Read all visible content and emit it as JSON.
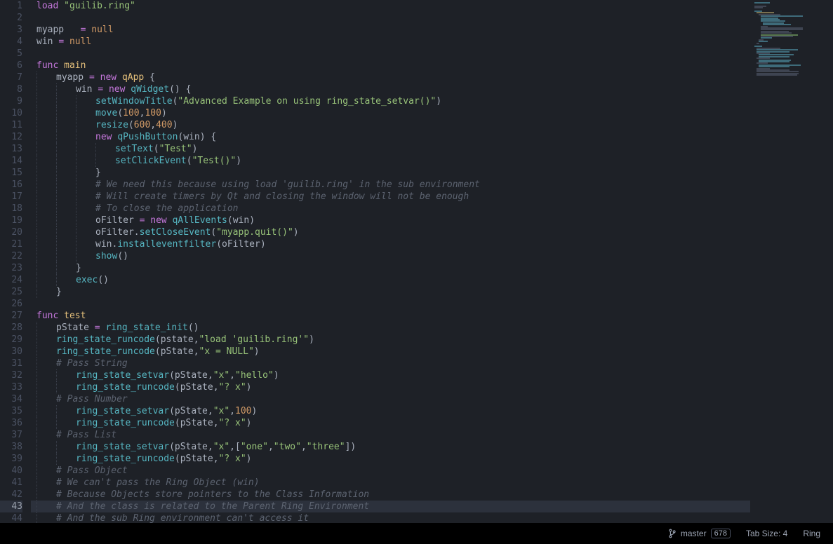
{
  "language": "Ring",
  "status": {
    "branch_label": "master",
    "change_count": "678",
    "tab_size_label": "Tab Size: 4",
    "language_label": "Ring"
  },
  "current_line": 43,
  "lines": [
    {
      "n": 1,
      "indent": 0,
      "tokens": [
        [
          "kw",
          "load"
        ],
        [
          "sp",
          " "
        ],
        [
          "str",
          "\"guilib.ring\""
        ]
      ]
    },
    {
      "n": 2,
      "indent": 0,
      "tokens": []
    },
    {
      "n": 3,
      "indent": 0,
      "tokens": [
        [
          "id",
          "myapp   "
        ],
        [
          "eq",
          "="
        ],
        [
          "sp",
          " "
        ],
        [
          "null",
          "null"
        ]
      ]
    },
    {
      "n": 4,
      "indent": 0,
      "tokens": [
        [
          "id",
          "win "
        ],
        [
          "eq",
          "="
        ],
        [
          "sp",
          " "
        ],
        [
          "null",
          "null"
        ]
      ]
    },
    {
      "n": 5,
      "indent": 0,
      "tokens": []
    },
    {
      "n": 6,
      "indent": 0,
      "tokens": [
        [
          "kw",
          "func"
        ],
        [
          "sp",
          " "
        ],
        [
          "name",
          "main"
        ]
      ]
    },
    {
      "n": 7,
      "indent": 1,
      "tokens": [
        [
          "id",
          "myapp "
        ],
        [
          "eq",
          "="
        ],
        [
          "sp",
          " "
        ],
        [
          "kw",
          "new"
        ],
        [
          "sp",
          " "
        ],
        [
          "name",
          "qApp"
        ],
        [
          "sp",
          " "
        ],
        [
          "pun",
          "{"
        ]
      ]
    },
    {
      "n": 8,
      "indent": 2,
      "tokens": [
        [
          "id",
          "win "
        ],
        [
          "eq",
          "="
        ],
        [
          "sp",
          " "
        ],
        [
          "kw",
          "new"
        ],
        [
          "sp",
          " "
        ],
        [
          "fn",
          "qWidget"
        ],
        [
          "pun",
          "()"
        ],
        [
          "sp",
          " "
        ],
        [
          "pun",
          "{"
        ]
      ]
    },
    {
      "n": 9,
      "indent": 3,
      "tokens": [
        [
          "fn",
          "setWindowTitle"
        ],
        [
          "pun",
          "("
        ],
        [
          "str",
          "\"Advanced Example on using ring_state_setvar()\""
        ],
        [
          "pun",
          ")"
        ]
      ]
    },
    {
      "n": 10,
      "indent": 3,
      "tokens": [
        [
          "fn",
          "move"
        ],
        [
          "pun",
          "("
        ],
        [
          "num",
          "100"
        ],
        [
          "pun",
          ","
        ],
        [
          "num",
          "100"
        ],
        [
          "pun",
          ")"
        ]
      ]
    },
    {
      "n": 11,
      "indent": 3,
      "tokens": [
        [
          "fn",
          "resize"
        ],
        [
          "pun",
          "("
        ],
        [
          "num",
          "600"
        ],
        [
          "pun",
          ","
        ],
        [
          "num",
          "400"
        ],
        [
          "pun",
          ")"
        ]
      ]
    },
    {
      "n": 12,
      "indent": 3,
      "tokens": [
        [
          "kw",
          "new"
        ],
        [
          "sp",
          " "
        ],
        [
          "fn",
          "qPushButton"
        ],
        [
          "pun",
          "("
        ],
        [
          "id",
          "win"
        ],
        [
          "pun",
          ")"
        ],
        [
          "sp",
          " "
        ],
        [
          "pun",
          "{"
        ]
      ]
    },
    {
      "n": 13,
      "indent": 4,
      "tokens": [
        [
          "fn",
          "setText"
        ],
        [
          "pun",
          "("
        ],
        [
          "str",
          "\"Test\""
        ],
        [
          "pun",
          ")"
        ]
      ]
    },
    {
      "n": 14,
      "indent": 4,
      "tokens": [
        [
          "fn",
          "setClickEvent"
        ],
        [
          "pun",
          "("
        ],
        [
          "str",
          "\"Test()\""
        ],
        [
          "pun",
          ")"
        ]
      ]
    },
    {
      "n": 15,
      "indent": 3,
      "tokens": [
        [
          "pun",
          "}"
        ]
      ]
    },
    {
      "n": 16,
      "indent": 3,
      "tokens": [
        [
          "cmt",
          "# We need this because using load 'guilib.ring' in the sub environment"
        ]
      ]
    },
    {
      "n": 17,
      "indent": 3,
      "tokens": [
        [
          "cmt",
          "# Will create timers by Qt and closing the window will not be enough"
        ]
      ]
    },
    {
      "n": 18,
      "indent": 3,
      "tokens": [
        [
          "cmt",
          "# To close the application"
        ]
      ]
    },
    {
      "n": 19,
      "indent": 3,
      "tokens": [
        [
          "id",
          "oFilter "
        ],
        [
          "eq",
          "="
        ],
        [
          "sp",
          " "
        ],
        [
          "kw",
          "new"
        ],
        [
          "sp",
          " "
        ],
        [
          "fn",
          "qAllEvents"
        ],
        [
          "pun",
          "("
        ],
        [
          "id",
          "win"
        ],
        [
          "pun",
          ")"
        ]
      ]
    },
    {
      "n": 20,
      "indent": 3,
      "tokens": [
        [
          "id",
          "oFilter"
        ],
        [
          "pun",
          "."
        ],
        [
          "fn",
          "setCloseEvent"
        ],
        [
          "pun",
          "("
        ],
        [
          "str",
          "\"myapp.quit()\""
        ],
        [
          "pun",
          ")"
        ]
      ]
    },
    {
      "n": 21,
      "indent": 3,
      "tokens": [
        [
          "id",
          "win"
        ],
        [
          "pun",
          "."
        ],
        [
          "fn",
          "installeventfilter"
        ],
        [
          "pun",
          "("
        ],
        [
          "id",
          "oFilter"
        ],
        [
          "pun",
          ")"
        ]
      ]
    },
    {
      "n": 22,
      "indent": 3,
      "tokens": [
        [
          "fn",
          "show"
        ],
        [
          "pun",
          "()"
        ]
      ]
    },
    {
      "n": 23,
      "indent": 2,
      "tokens": [
        [
          "pun",
          "}"
        ]
      ]
    },
    {
      "n": 24,
      "indent": 2,
      "tokens": [
        [
          "fn",
          "exec"
        ],
        [
          "pun",
          "()"
        ]
      ]
    },
    {
      "n": 25,
      "indent": 1,
      "tokens": [
        [
          "pun",
          "}"
        ]
      ]
    },
    {
      "n": 26,
      "indent": 0,
      "tokens": []
    },
    {
      "n": 27,
      "indent": 0,
      "tokens": [
        [
          "kw",
          "func"
        ],
        [
          "sp",
          " "
        ],
        [
          "name",
          "test"
        ]
      ]
    },
    {
      "n": 28,
      "indent": 1,
      "tokens": [
        [
          "id",
          "pState "
        ],
        [
          "eq",
          "="
        ],
        [
          "sp",
          " "
        ],
        [
          "fn",
          "ring_state_init"
        ],
        [
          "pun",
          "()"
        ]
      ]
    },
    {
      "n": 29,
      "indent": 1,
      "tokens": [
        [
          "fn",
          "ring_state_runcode"
        ],
        [
          "pun",
          "("
        ],
        [
          "id",
          "pstate"
        ],
        [
          "pun",
          ","
        ],
        [
          "str",
          "\"load 'guilib.ring'\""
        ],
        [
          "pun",
          ")"
        ]
      ]
    },
    {
      "n": 30,
      "indent": 1,
      "tokens": [
        [
          "fn",
          "ring_state_runcode"
        ],
        [
          "pun",
          "("
        ],
        [
          "id",
          "pState"
        ],
        [
          "pun",
          ","
        ],
        [
          "str",
          "\"x = NULL\""
        ],
        [
          "pun",
          ")"
        ]
      ]
    },
    {
      "n": 31,
      "indent": 1,
      "tokens": [
        [
          "cmt",
          "# Pass String"
        ]
      ]
    },
    {
      "n": 32,
      "indent": 2,
      "tokens": [
        [
          "fn",
          "ring_state_setvar"
        ],
        [
          "pun",
          "("
        ],
        [
          "id",
          "pState"
        ],
        [
          "pun",
          ","
        ],
        [
          "str",
          "\"x\""
        ],
        [
          "pun",
          ","
        ],
        [
          "str",
          "\"hello\""
        ],
        [
          "pun",
          ")"
        ]
      ]
    },
    {
      "n": 33,
      "indent": 2,
      "tokens": [
        [
          "fn",
          "ring_state_runcode"
        ],
        [
          "pun",
          "("
        ],
        [
          "id",
          "pState"
        ],
        [
          "pun",
          ","
        ],
        [
          "str",
          "\"? x\""
        ],
        [
          "pun",
          ")"
        ]
      ]
    },
    {
      "n": 34,
      "indent": 1,
      "tokens": [
        [
          "cmt",
          "# Pass Number"
        ]
      ]
    },
    {
      "n": 35,
      "indent": 2,
      "tokens": [
        [
          "fn",
          "ring_state_setvar"
        ],
        [
          "pun",
          "("
        ],
        [
          "id",
          "pState"
        ],
        [
          "pun",
          ","
        ],
        [
          "str",
          "\"x\""
        ],
        [
          "pun",
          ","
        ],
        [
          "num",
          "100"
        ],
        [
          "pun",
          ")"
        ]
      ]
    },
    {
      "n": 36,
      "indent": 2,
      "tokens": [
        [
          "fn",
          "ring_state_runcode"
        ],
        [
          "pun",
          "("
        ],
        [
          "id",
          "pState"
        ],
        [
          "pun",
          ","
        ],
        [
          "str",
          "\"? x\""
        ],
        [
          "pun",
          ")"
        ]
      ]
    },
    {
      "n": 37,
      "indent": 1,
      "tokens": [
        [
          "cmt",
          "# Pass List"
        ]
      ]
    },
    {
      "n": 38,
      "indent": 2,
      "tokens": [
        [
          "fn",
          "ring_state_setvar"
        ],
        [
          "pun",
          "("
        ],
        [
          "id",
          "pState"
        ],
        [
          "pun",
          ","
        ],
        [
          "str",
          "\"x\""
        ],
        [
          "pun",
          ",["
        ],
        [
          "str",
          "\"one\""
        ],
        [
          "pun",
          ","
        ],
        [
          "str",
          "\"two\""
        ],
        [
          "pun",
          ","
        ],
        [
          "str",
          "\"three\""
        ],
        [
          "pun",
          "])"
        ]
      ]
    },
    {
      "n": 39,
      "indent": 2,
      "tokens": [
        [
          "fn",
          "ring_state_runcode"
        ],
        [
          "pun",
          "("
        ],
        [
          "id",
          "pState"
        ],
        [
          "pun",
          ","
        ],
        [
          "str",
          "\"? x\""
        ],
        [
          "pun",
          ")"
        ]
      ]
    },
    {
      "n": 40,
      "indent": 1,
      "tokens": [
        [
          "cmt",
          "# Pass Object"
        ]
      ]
    },
    {
      "n": 41,
      "indent": 1,
      "tokens": [
        [
          "cmt",
          "# We can't pass the Ring Object (win)"
        ]
      ]
    },
    {
      "n": 42,
      "indent": 1,
      "tokens": [
        [
          "cmt",
          "# Because Objects store pointers to the Class Information"
        ]
      ]
    },
    {
      "n": 43,
      "indent": 1,
      "tokens": [
        [
          "cmt",
          "# And the class is related to the Parent Ring Environment"
        ]
      ]
    },
    {
      "n": 44,
      "indent": 1,
      "tokens": [
        [
          "cmt",
          "# And the sub Ring environment can't access it"
        ]
      ]
    }
  ]
}
